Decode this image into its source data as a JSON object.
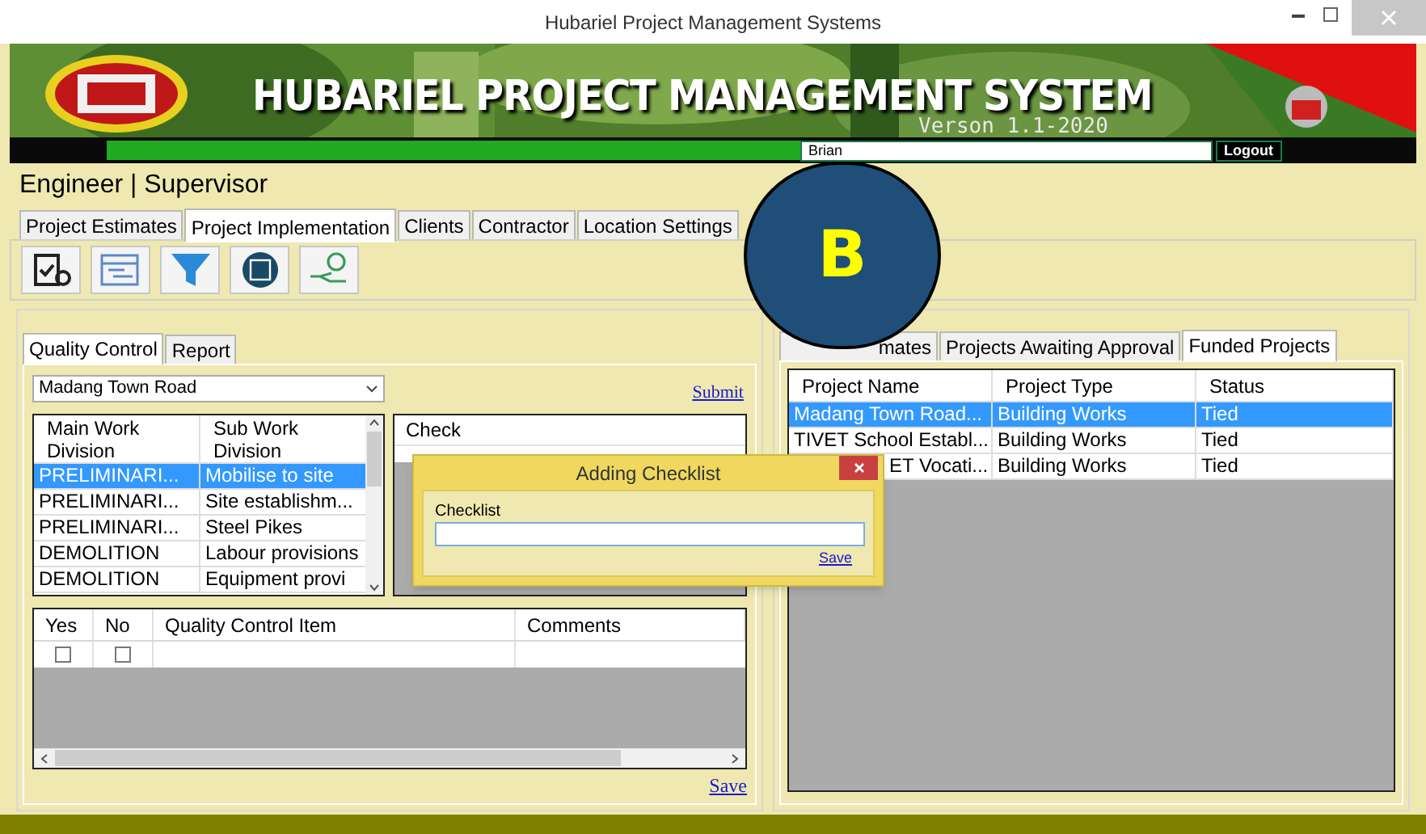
{
  "window": {
    "title": "Hubariel Project Management Systems"
  },
  "banner": {
    "title": "HUBARIEL PROJECT MANAGEMENT SYSTEM",
    "version": "Verson 1.1-2020",
    "user_field": {
      "value": "Brian"
    },
    "logout": "Logout"
  },
  "role": "Engineer | Supervisor",
  "tabs": [
    {
      "label": "Project Estimates",
      "selected": false
    },
    {
      "label": "Project Implementation",
      "selected": true
    },
    {
      "label": "Clients",
      "selected": false
    },
    {
      "label": "Contractor",
      "selected": false
    },
    {
      "label": "Location Settings",
      "selected": false
    }
  ],
  "quality_panel": {
    "tabs": [
      {
        "label": "Quality Control",
        "selected": true
      },
      {
        "label": "Report",
        "selected": false
      }
    ],
    "project_select": {
      "value": "Madang Town Road"
    },
    "submit": "Submit",
    "work_grid": {
      "columns": [
        "Main Work Division",
        "Sub Work Division"
      ],
      "rows": [
        {
          "cells": [
            "PRELIMINARI...",
            "Mobilise to site"
          ],
          "selected": true
        },
        {
          "cells": [
            "PRELIMINARI...",
            "Site establishm..."
          ],
          "selected": false
        },
        {
          "cells": [
            "PRELIMINARI...",
            "Steel Pikes"
          ],
          "selected": false
        },
        {
          "cells": [
            "DEMOLITION",
            "Labour provisions"
          ],
          "selected": false
        },
        {
          "cells": [
            "DEMOLITION",
            "Equipment provi"
          ],
          "selected": false
        }
      ]
    },
    "check_grid": {
      "columns": [
        "Check"
      ]
    },
    "qc_grid": {
      "columns": [
        "Yes",
        "No",
        "Quality Control Item",
        "Comments"
      ],
      "rows": [
        {
          "yes": false,
          "no": false
        }
      ]
    },
    "save": "Save"
  },
  "projects_panel": {
    "tabs": [
      {
        "label": "mates",
        "selected": false
      },
      {
        "label": "Projects Awaiting Approval",
        "selected": false
      },
      {
        "label": "Funded Projects",
        "selected": true
      }
    ],
    "table": {
      "columns": [
        "Project Name",
        "Project Type",
        "Status"
      ],
      "rows": [
        {
          "cells": [
            "Madang Town Road...",
            "Building Works",
            "Tied"
          ],
          "selected": true
        },
        {
          "cells": [
            "TIVET School Establ...",
            "Building Works",
            "Tied"
          ],
          "selected": false
        },
        {
          "cells": [
            "ET Vocati...",
            "Building Works",
            "Tied"
          ],
          "selected": false
        }
      ]
    }
  },
  "dialog": {
    "title": "Adding Checklist",
    "field_label": "Checklist",
    "save": "Save"
  },
  "marker": {
    "label": "B"
  }
}
